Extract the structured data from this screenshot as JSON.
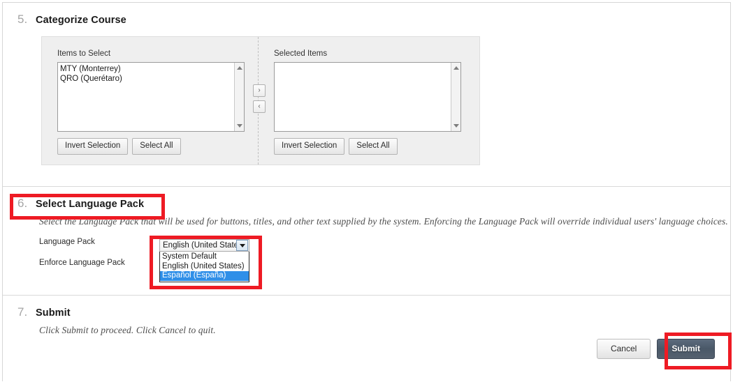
{
  "steps": [
    {
      "number": "5.",
      "title": "Categorize Course",
      "picker": {
        "left_label": "Items to Select",
        "right_label": "Selected Items",
        "left_items": [
          "MTY (Monterrey)",
          "QRO (Querétaro)"
        ],
        "right_items": [],
        "move_right_icon": "›",
        "move_left_icon": "‹",
        "invert_label": "Invert Selection",
        "select_all_label": "Select All"
      }
    },
    {
      "number": "6.",
      "title": "Select Language Pack",
      "description": "Select the Language Pack that will be used for buttons, titles, and other text supplied by the system. Enforcing the Language Pack will override individual users' language choices.",
      "fields": {
        "language_pack_label": "Language Pack",
        "enforce_label": "Enforce Language Pack",
        "enforce_checked": false
      },
      "dropdown": {
        "selected_value": "English (United States)",
        "open": true,
        "options": [
          {
            "label": "System Default",
            "highlighted": false
          },
          {
            "label": "English (United States)",
            "highlighted": false
          },
          {
            "label": "Español (España)",
            "highlighted": true
          }
        ]
      }
    },
    {
      "number": "7.",
      "title": "Submit",
      "description": "Click Submit to proceed. Click Cancel to quit.",
      "actions": {
        "cancel_label": "Cancel",
        "submit_label": "Submit"
      }
    }
  ],
  "colors": {
    "annotation_red": "#ee1b24",
    "option_highlight_blue": "#2f8fe8",
    "submit_button": "#4a5868",
    "panel_background": "#efefef",
    "step_number_gray": "#a5a5a5"
  }
}
